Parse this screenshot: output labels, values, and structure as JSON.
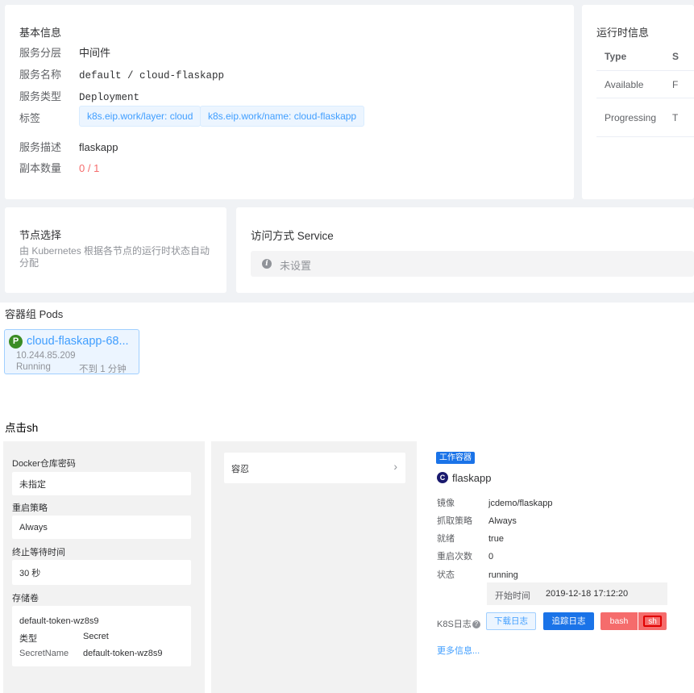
{
  "basic_info": {
    "title": "基本信息",
    "rows": [
      {
        "label": "服务分层",
        "value": "中间件"
      },
      {
        "label": "服务名称",
        "value": "default / cloud-flaskapp"
      },
      {
        "label": "服务类型",
        "value": "Deployment"
      },
      {
        "label": "标签",
        "value": ""
      },
      {
        "label": "服务描述",
        "value": "flaskapp"
      },
      {
        "label": "副本数量",
        "value": "0 / 1"
      }
    ],
    "tags": [
      "k8s.eip.work/layer: cloud",
      "k8s.eip.work/name: cloud-flaskapp"
    ]
  },
  "runtime": {
    "title": "运行时信息",
    "header": {
      "type": "Type",
      "status": "S"
    },
    "rows": [
      {
        "type": "Available",
        "status": "F"
      },
      {
        "type": "Progressing",
        "status": "T"
      }
    ]
  },
  "node_select": {
    "title": "节点选择",
    "desc": "由 Kubernetes 根据各节点的运行时状态自动分配"
  },
  "service": {
    "title": "访问方式 Service",
    "empty": "未设置"
  },
  "pods": {
    "title": "容器组 Pods",
    "items": [
      {
        "badge": "P",
        "name": "cloud-flaskapp-68...",
        "ip": "10.244.85.209",
        "status": "Running",
        "age": "不到 1 分钟"
      }
    ]
  },
  "note": "点击sh",
  "left_panel": {
    "docker_label": "Docker仓库密码",
    "docker_value": "未指定",
    "restart_label": "重启策略",
    "restart_value": "Always",
    "termination_label": "终止等待时间",
    "termination_value": "30 秒",
    "volume_label": "存储卷",
    "volume_name": "default-token-wz8s9",
    "volume_type_label": "类型",
    "volume_type_value": "Secret",
    "secret_label": "SecretName",
    "secret_value": "default-token-wz8s9"
  },
  "mid_panel": {
    "item_label": "容忍",
    "chevron": "›"
  },
  "container": {
    "badge": "工作容器",
    "icon_letter": "C",
    "name": "flaskapp",
    "rows": [
      {
        "label": "镜像",
        "value": "jcdemo/flaskapp"
      },
      {
        "label": "抓取策略",
        "value": "Always"
      },
      {
        "label": "就绪",
        "value": "true"
      },
      {
        "label": "重启次数",
        "value": "0"
      },
      {
        "label": "状态",
        "value": "running"
      }
    ],
    "start_label": "开始时间",
    "start_value": "2019-12-18 17:12:20",
    "logs_label": "K8S日志",
    "logs_help": "?",
    "btn_download": "下载日志",
    "btn_tail": "追踪日志",
    "btn_bash": "bash",
    "btn_sh": "sh",
    "more": "更多信息..."
  },
  "colors": {
    "primary": "#409eff",
    "danger": "#f56c6c",
    "pod_badge": "#3a8c23"
  }
}
